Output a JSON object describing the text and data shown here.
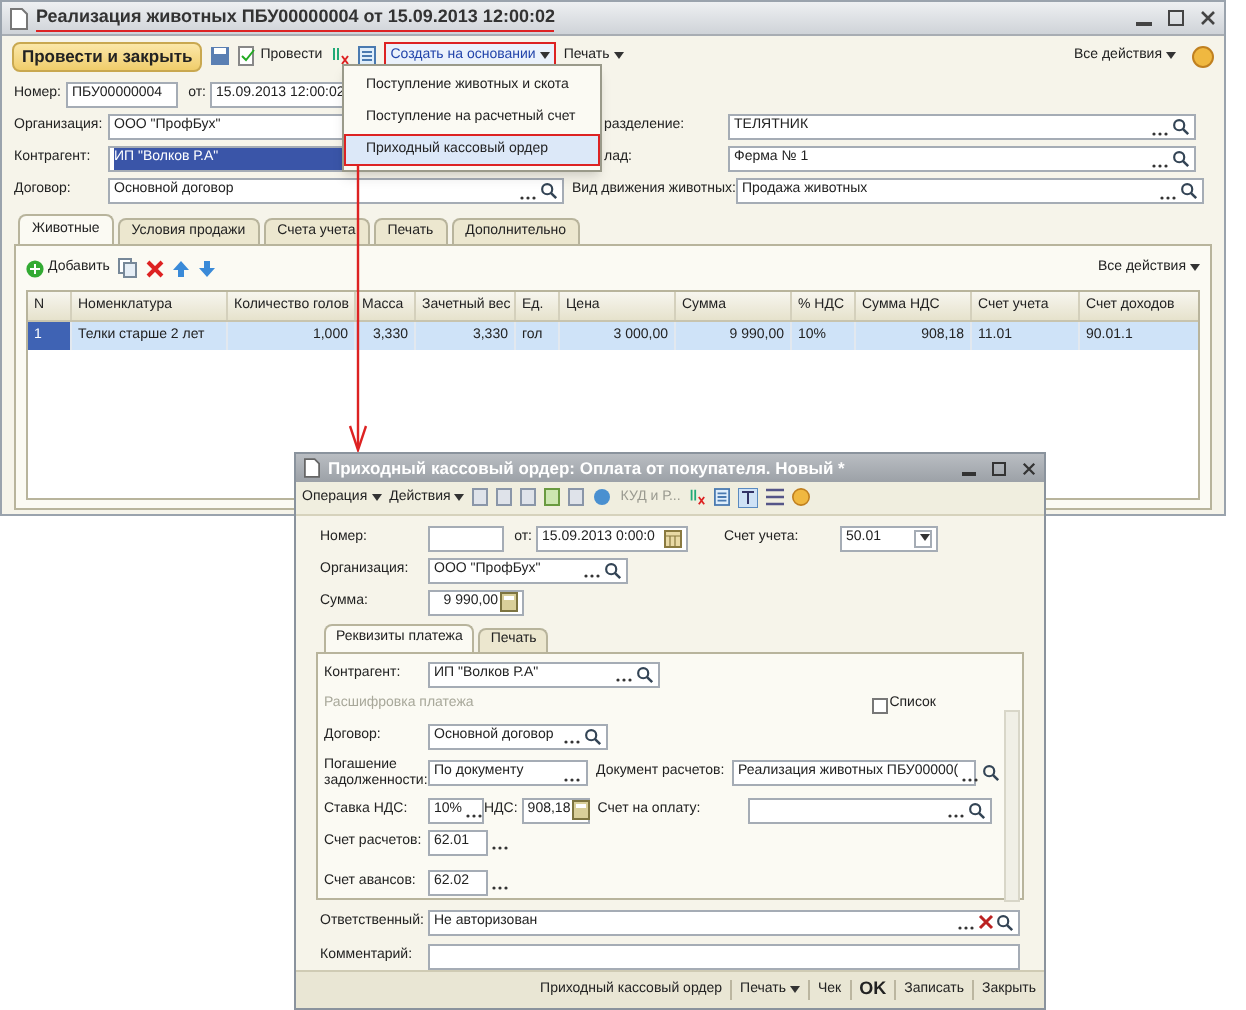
{
  "main_window": {
    "title": "Реализация животных ПБУ00000004 от 15.09.2013 12:00:02",
    "toolbar": {
      "post_close": "Провести и закрыть",
      "post": "Провести",
      "create_based": "Создать на основании",
      "print": "Печать",
      "all_actions": "Все действия"
    },
    "create_menu": [
      {
        "label": "Поступление животных и скота",
        "selected": false
      },
      {
        "label": "Поступление на расчетный счет",
        "selected": false
      },
      {
        "label": "Приходный кассовый ордер",
        "selected": true
      }
    ],
    "number": {
      "label": "Номер:",
      "value": "ПБУ00000004"
    },
    "date": {
      "label": "от:",
      "value": "15.09.2013 12:00:02"
    },
    "organization": {
      "label": "Организация:",
      "value": "ООО \"ПрофБух\""
    },
    "department": {
      "label": "разделение:",
      "value": "ТЕЛЯТНИК"
    },
    "counterparty": {
      "label": "Контрагент:",
      "value": "ИП \"Волков Р.А\"",
      "selected": true
    },
    "warehouse": {
      "label": "лад:",
      "value": "Ферма № 1"
    },
    "contract": {
      "label": "Договор:",
      "value": "Основной договор"
    },
    "movement": {
      "label": "Вид движения животных:",
      "value": "Продажа животных"
    },
    "tabs": [
      {
        "label": "Животные",
        "selected": true
      },
      {
        "label": "Условия продажи",
        "selected": false
      },
      {
        "label": "Счета учета",
        "selected": false
      },
      {
        "label": "Печать",
        "selected": false
      },
      {
        "label": "Дополнительно",
        "selected": false
      }
    ],
    "table_toolbar": {
      "add": "Добавить",
      "all_actions": "Все действия"
    },
    "table": {
      "columns": [
        "N",
        "Номенклатура",
        "Количество голов",
        "Масса",
        "Зачетный вес",
        "Ед.",
        "Цена",
        "Сумма",
        "% НДС",
        "Сумма НДС",
        "Счет учета",
        "Счет доходов"
      ],
      "rows": [
        {
          "cells": [
            "1",
            "Телки старше 2 лет",
            "1,000",
            "3,330",
            "3,330",
            "гол",
            "3 000,00",
            "9 990,00",
            "10%",
            "908,18",
            "11.01",
            "90.01.1"
          ],
          "selected": true
        }
      ]
    }
  },
  "order_window": {
    "title": "Приходный кассовый ордер: Оплата от покупателя. Новый *",
    "toolbar": {
      "operation": "Операция",
      "actions": "Действия",
      "kudir": "КУД и Р..."
    },
    "number": {
      "label": "Номер:"
    },
    "date": {
      "label": "от:",
      "value": "15.09.2013 0:00:0"
    },
    "account": {
      "label": "Счет учета:",
      "value": "50.01"
    },
    "organization": {
      "label": "Организация:",
      "value": "ООО \"ПрофБух\""
    },
    "amount": {
      "label": "Сумма:",
      "value": "9 990,00"
    },
    "tabs": [
      {
        "label": "Реквизиты платежа",
        "selected": true
      },
      {
        "label": "Печать",
        "selected": false
      }
    ],
    "counterparty": {
      "label": "Контрагент:",
      "value": "ИП \"Волков Р.А\""
    },
    "breakdown": "Расшифровка платежа",
    "list_checkbox": {
      "label": "Список",
      "checked": false
    },
    "contract": {
      "label": "Договор:",
      "value": "Основной договор"
    },
    "repayment": {
      "label": "Погашение задолженности:",
      "value": "По документу"
    },
    "settlement_doc": {
      "label": "Документ расчетов:",
      "value": "Реализация животных ПБУ00000("
    },
    "vat_rate": {
      "label": "Ставка НДС:",
      "value": "10%"
    },
    "vat": {
      "label": "НДС:",
      "value": "908,18"
    },
    "invoice": {
      "label": "Счет на оплату:"
    },
    "settlement_account": {
      "label": "Счет расчетов:",
      "value": "62.01"
    },
    "advance_account": {
      "label": "Счет авансов:",
      "value": "62.02"
    },
    "responsible": {
      "label": "Ответственный:",
      "value": "Не авторизован"
    },
    "comment": {
      "label": "Комментарий:"
    },
    "footer": [
      {
        "label": "Приходный кассовый ордер",
        "kind": "link"
      },
      {
        "label": "Печать",
        "kind": "menu"
      },
      {
        "label": "Чек",
        "kind": "link"
      },
      {
        "label": "OK",
        "kind": "bold"
      },
      {
        "label": "Записать",
        "kind": "link"
      },
      {
        "label": "Закрыть",
        "kind": "link"
      }
    ]
  }
}
